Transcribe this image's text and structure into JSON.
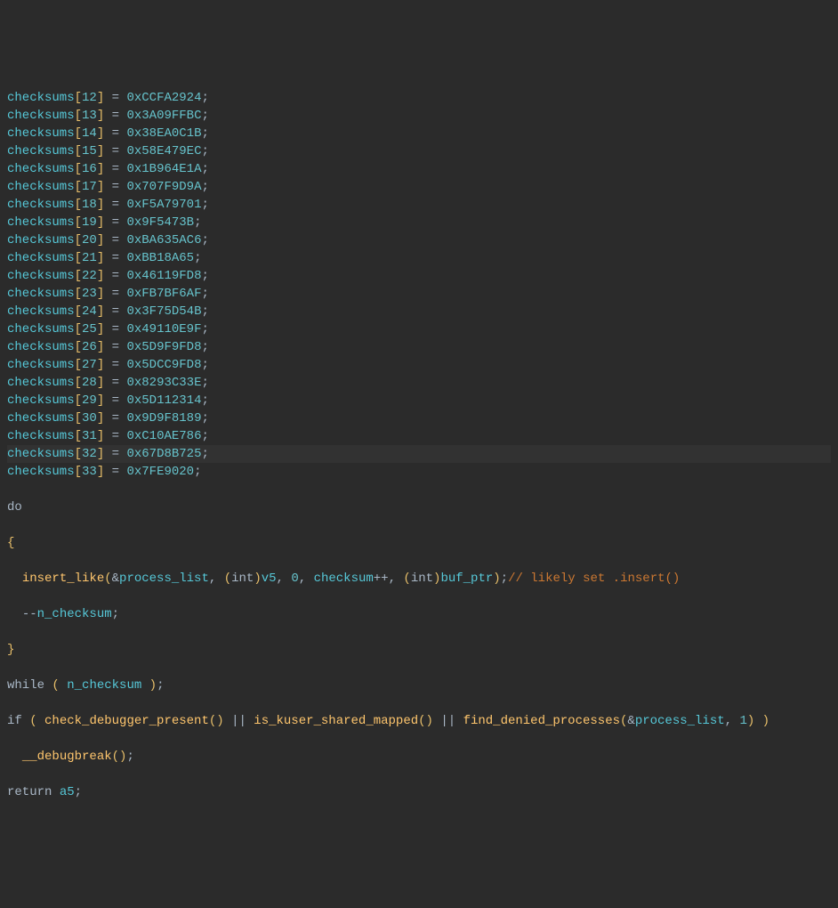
{
  "assignments": [
    {
      "name": "checksums",
      "idx": "12",
      "val": "0xCCFA2924"
    },
    {
      "name": "checksums",
      "idx": "13",
      "val": "0x3A09FFBC"
    },
    {
      "name": "checksums",
      "idx": "14",
      "val": "0x38EA0C1B"
    },
    {
      "name": "checksums",
      "idx": "15",
      "val": "0x58E479EC"
    },
    {
      "name": "checksums",
      "idx": "16",
      "val": "0x1B964E1A"
    },
    {
      "name": "checksums",
      "idx": "17",
      "val": "0x707F9D9A"
    },
    {
      "name": "checksums",
      "idx": "18",
      "val": "0xF5A79701"
    },
    {
      "name": "checksums",
      "idx": "19",
      "val": "0x9F5473B"
    },
    {
      "name": "checksums",
      "idx": "20",
      "val": "0xBA635AC6"
    },
    {
      "name": "checksums",
      "idx": "21",
      "val": "0xBB18A65"
    },
    {
      "name": "checksums",
      "idx": "22",
      "val": "0x46119FD8"
    },
    {
      "name": "checksums",
      "idx": "23",
      "val": "0xFB7BF6AF"
    },
    {
      "name": "checksums",
      "idx": "24",
      "val": "0x3F75D54B"
    },
    {
      "name": "checksums",
      "idx": "25",
      "val": "0x49110E9F"
    },
    {
      "name": "checksums",
      "idx": "26",
      "val": "0x5D9F9FD8"
    },
    {
      "name": "checksums",
      "idx": "27",
      "val": "0x5DCC9FD8"
    },
    {
      "name": "checksums",
      "idx": "28",
      "val": "0x8293C33E"
    },
    {
      "name": "checksums",
      "idx": "29",
      "val": "0x5D112314"
    },
    {
      "name": "checksums",
      "idx": "30",
      "val": "0x9D9F8189"
    },
    {
      "name": "checksums",
      "idx": "31",
      "val": "0xC10AE786"
    },
    {
      "name": "checksums",
      "idx": "32",
      "val": "0x67D8B725",
      "hl": true
    },
    {
      "name": "checksums",
      "idx": "33",
      "val": "0x7FE9020"
    }
  ],
  "kw_do": "do",
  "brace_open": "{",
  "brace_close": "}",
  "call": {
    "fn": "insert_like",
    "arg0_amp": "&",
    "arg0": "process_list",
    "arg1_paren_open": "(",
    "arg1_type": "int",
    "arg1_paren_close": ")",
    "arg1_name": "v5",
    "arg2": "0",
    "arg3_name": "checksum",
    "arg3_op": "++",
    "arg4_paren_open": "(",
    "arg4_type": "int",
    "arg4_paren_close": ")",
    "arg4_name": "buf_ptr",
    "close": ")",
    "semi": ";",
    "comment": "// likely set .insert()"
  },
  "decr": {
    "op": "--",
    "name": "n_checksum",
    "semi": ";"
  },
  "while": {
    "kw": "while",
    "open": " ( ",
    "name": "n_checksum",
    "close": " )",
    "semi": ";"
  },
  "ifline": {
    "kw": "if",
    "open": " ( ",
    "fn1": "check_debugger_present",
    "call1": "()",
    "or": " || ",
    "fn2": "is_kuser_shared_mapped",
    "call2": "()",
    "fn3": "find_denied_processes",
    "args3_open": "(",
    "args3_amp": "&",
    "args3_arg0": "process_list",
    "args3_sep": ", ",
    "args3_arg1": "1",
    "args3_close": ")",
    "close": " )"
  },
  "debugbreak": {
    "fn": "__debugbreak",
    "call": "()",
    "semi": ";"
  },
  "ret": {
    "kw": "return",
    "name": "a5",
    "semi": ";"
  }
}
